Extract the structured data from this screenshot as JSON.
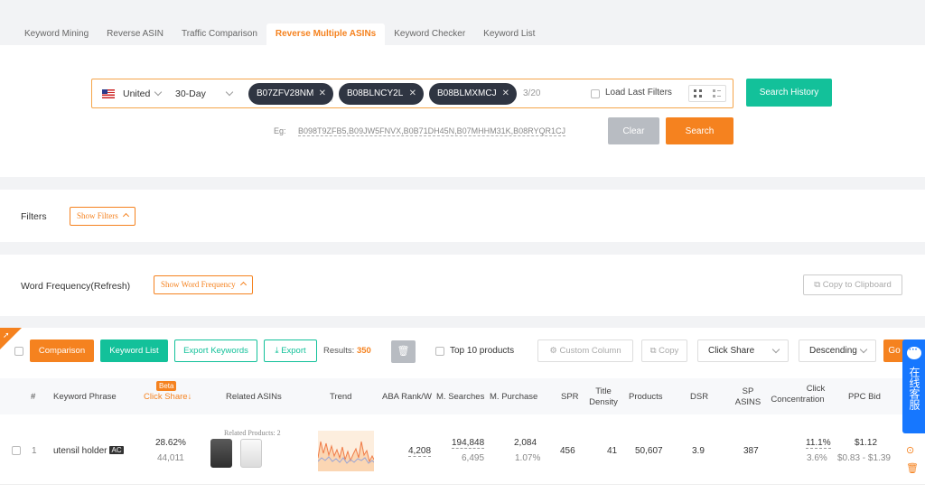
{
  "tabs": [
    "Keyword Mining",
    "Reverse ASIN",
    "Traffic Comparison",
    "Reverse Multiple ASINs",
    "Keyword Checker",
    "Keyword List"
  ],
  "search": {
    "country": "United",
    "period": "30-Day",
    "asins": [
      "B07ZFV28NM",
      "B08BLNCY2L",
      "B08BLMXMCJ"
    ],
    "count": "3/20",
    "load_last_filters": "Load Last Filters",
    "search_history": "Search History",
    "example_label": "Eg:",
    "example_value": "B098T9ZFB5,B09JW5FNVX,B0B71DH45N,B07MHHM31K,B08RYQR1CJ",
    "clear": "Clear",
    "search": "Search"
  },
  "filters": {
    "label": "Filters",
    "show": "Show Filters"
  },
  "word_frequency": {
    "label": "Word Frequency(Refresh)",
    "show": "Show Word Frequency",
    "copy": "Copy to Clipboard"
  },
  "toolbar": {
    "comparison": "Comparison",
    "keyword_list": "Keyword List",
    "export_keywords": "Export Keywords",
    "export": "Export",
    "results_label": "Results:",
    "results_count": "350",
    "top10": "Top 10 products",
    "custom_column": "Custom Column",
    "copy": "Copy",
    "sort_field": "Click Share",
    "sort_order": "Descending",
    "go": "Go"
  },
  "columns": {
    "num": "#",
    "keyword": "Keyword Phrase",
    "beta": "Beta",
    "click_share": "Click Share",
    "related_asins": "Related ASINs",
    "trend": "Trend",
    "aba_rank": "ABA Rank/W",
    "searches": "M. Searches",
    "purchase": "M. Purchase",
    "spr": "SPR",
    "title_density": [
      "Title",
      "Density"
    ],
    "products": "Products",
    "dsr": "DSR",
    "sp_asins": [
      "SP",
      "ASINS"
    ],
    "click_conc": [
      "Click",
      "Concentration"
    ],
    "ppc_bid": "PPC Bid"
  },
  "rows": [
    {
      "num": "1",
      "keyword": "utensil holder",
      "badge": "AC",
      "click_share": "28.62%",
      "click_share_sub": "44,011",
      "related_products": "Related Products: 2",
      "aba_rank": "4,208",
      "searches": "194,848",
      "searches_sub": "6,495",
      "purchase": "2,084",
      "purchase_sub": "1.07%",
      "spr": "456",
      "title_density": "41",
      "products": "50,607",
      "dsr": "3.9",
      "sp_asins": "387",
      "click_conc": "11.1%",
      "click_conc_sub": "3.6%",
      "ppc_bid": "$1.12",
      "ppc_range": "$0.83 - $1.39"
    }
  ],
  "chat": {
    "text": "在线客服"
  },
  "colors": {
    "accent": "#f5821f",
    "green": "#13c19a",
    "chip": "#2f3542",
    "chat": "#1677ff"
  }
}
